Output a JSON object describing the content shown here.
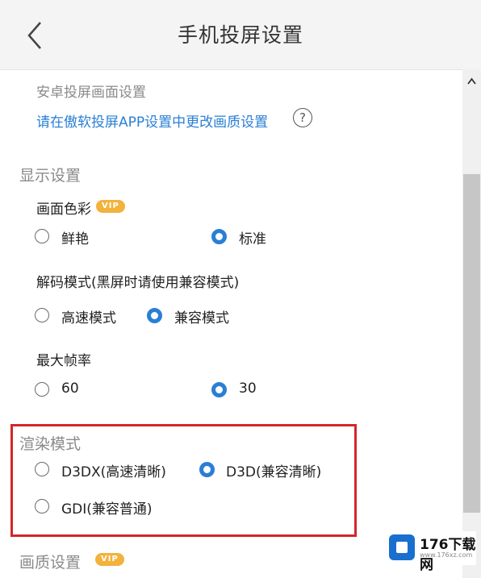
{
  "header": {
    "title": "手机投屏设置"
  },
  "android": {
    "title": "安卓投屏画面设置",
    "link": "请在傲软投屏APP设置中更改画质设置",
    "help": "?"
  },
  "display": {
    "title": "显示设置",
    "color": {
      "label": "画面色彩",
      "vip": "VIP",
      "options": [
        "鲜艳",
        "标准"
      ],
      "selected": "标准"
    },
    "decode": {
      "label": "解码模式(黑屏时请使用兼容模式)",
      "options": [
        "高速模式",
        "兼容模式"
      ],
      "selected": "兼容模式"
    },
    "fps": {
      "label": "最大帧率",
      "options": [
        "60",
        "30"
      ],
      "selected": "30"
    }
  },
  "render": {
    "title": "渲染模式",
    "options": [
      "D3DX(高速清晰)",
      "D3D(兼容清晰)",
      "GDI(兼容普通)"
    ],
    "selected": "D3D(兼容清晰)"
  },
  "quality": {
    "title": "画质设置",
    "vip": "VIP"
  },
  "watermark": {
    "text": "176下载网",
    "url": "www.176xz.com"
  },
  "colors": {
    "accent": "#2a7fd4",
    "highlight": "#d3262a",
    "vip": "#f2b23c"
  }
}
